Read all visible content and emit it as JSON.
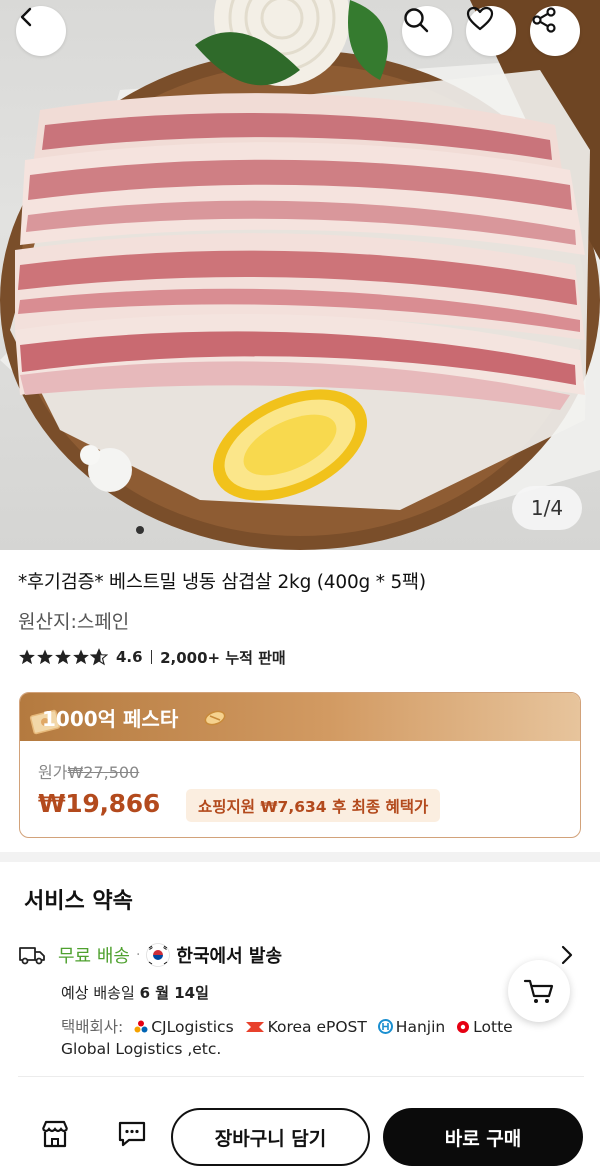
{
  "gallery": {
    "counter": "1/4",
    "image_description_icon": "pork-belly-photo"
  },
  "product": {
    "title": "*후기검증* 베스트밀 냉동 삼겹살 2kg (400g * 5팩)",
    "origin": "원산지:스페인",
    "rating": "4.6",
    "stars": 4.6,
    "sales": "2,000+ 누적 판매"
  },
  "price": {
    "festival_title": "1000억 페스타",
    "original_label": "원가",
    "original_price": "₩27,500",
    "final_price": "₩19,866",
    "benefit": "쇼핑지원 ₩7,634 후 최종 혜택가"
  },
  "service": {
    "title": "서비스 약속",
    "free_shipping": "무료 배송",
    "separator": "·",
    "ship_from": "한국에서 발송",
    "eta_label": "예상 배송일",
    "eta_date": "6 월 14일",
    "courier_label": "택배회사:",
    "couriers": [
      "CJLogistics",
      "Korea ePOST",
      "Hanjin",
      "Lotte"
    ],
    "courier_tail": "Global Logistics ,etc."
  },
  "actions": {
    "add_to_cart": "장바구니 담기",
    "buy_now": "바로 구매"
  },
  "colors": {
    "price_accent": "#b34a1d",
    "free_shipping": "#4fa12f",
    "festival_gold": "#c48a4f",
    "buy_button": "#0b0b0b"
  }
}
